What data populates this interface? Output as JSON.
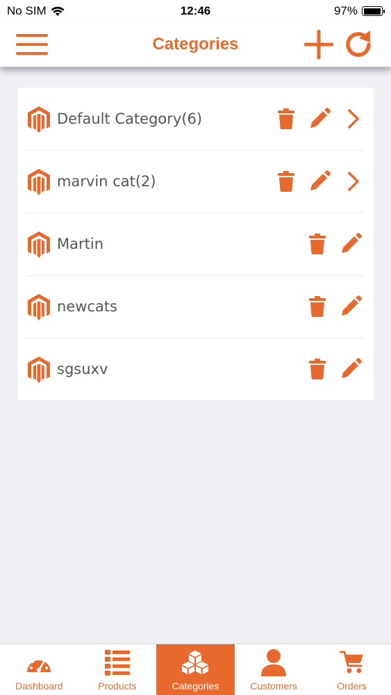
{
  "colors": {
    "accent": "#e8692e",
    "text": "#555555",
    "background": "#efeff4"
  },
  "status_bar": {
    "carrier": "No SIM",
    "time": "12:46",
    "battery": "97%",
    "battery_level": 0.97
  },
  "header": {
    "title": "Categories",
    "menu_icon": "hamburger-menu-icon",
    "add_icon": "plus-icon",
    "refresh_icon": "refresh-icon"
  },
  "categories": [
    {
      "label": "Default Category(6)",
      "has_children": true
    },
    {
      "label": "marvin cat(2)",
      "has_children": true
    },
    {
      "label": "Martin",
      "has_children": false
    },
    {
      "label": "newcats",
      "has_children": false
    },
    {
      "label": "sgsuxv",
      "has_children": false
    }
  ],
  "tabs": [
    {
      "label": "Dashboard",
      "icon": "speedometer-icon",
      "active": false
    },
    {
      "label": "Products",
      "icon": "list-icon",
      "active": false
    },
    {
      "label": "Categories",
      "icon": "boxes-icon",
      "active": true
    },
    {
      "label": "Customers",
      "icon": "person-icon",
      "active": false
    },
    {
      "label": "Orders",
      "icon": "cart-icon",
      "active": false
    }
  ]
}
